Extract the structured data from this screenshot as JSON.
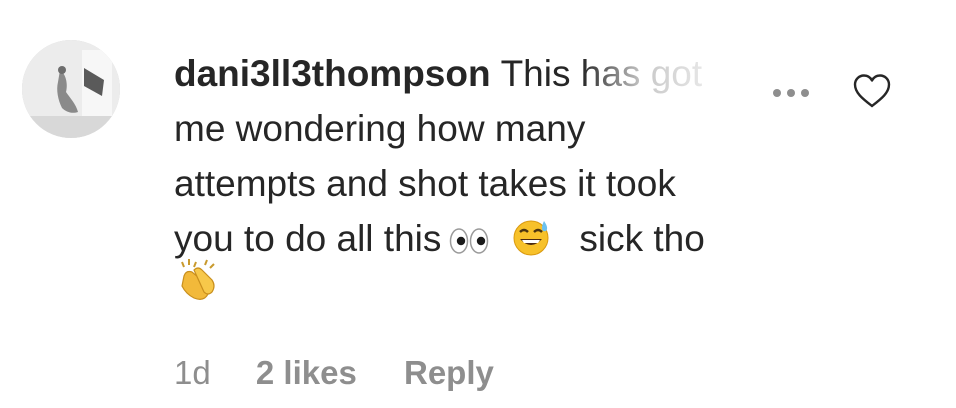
{
  "comment": {
    "username": "dani3ll3thompson",
    "line1": "This has got",
    "line2": "me wondering how many",
    "line3": "attempts and shot takes it took",
    "line4_text": "you to do all this",
    "line4_suffix": "sick tho",
    "emojis": [
      "eyes-emoji",
      "grinning-sweat-emoji",
      "clapping-hands-emoji"
    ],
    "more_icon": "ellipsis-icon",
    "like_icon": "heart-outline-icon"
  },
  "meta": {
    "time": "1d",
    "likes": "2 likes",
    "reply": "Reply"
  },
  "colors": {
    "text": "#262626",
    "secondary": "#8e8e8e",
    "background": "#ffffff"
  }
}
